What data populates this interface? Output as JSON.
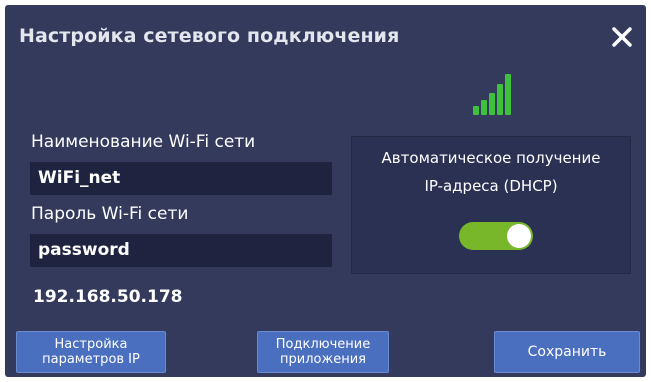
{
  "dialog": {
    "title": "Настройка сетевого подключения",
    "close_icon": "close-icon",
    "signal_icon": "wifi-signal-icon",
    "colors": {
      "background": "#333a5c",
      "field": "#1e2440",
      "button": "#4b6fbf",
      "toggle_on": "#78b62a",
      "signal": "#3ec23e"
    }
  },
  "wifi": {
    "name_label": "Наименование Wi-Fi сети",
    "name_value": "WiFi_net",
    "password_label": "Пароль Wi-Fi сети",
    "password_value": "password"
  },
  "ip_address": "192.168.50.178",
  "dhcp": {
    "label_line1": "Автоматическое получение",
    "label_line2": "IP-адреса (DHCP)",
    "enabled": true
  },
  "buttons": {
    "ip_settings_line1": "Настройка",
    "ip_settings_line2": "параметров IP",
    "app_connect_line1": "Подключение",
    "app_connect_line2": "приложения",
    "save": "Сохранить"
  }
}
